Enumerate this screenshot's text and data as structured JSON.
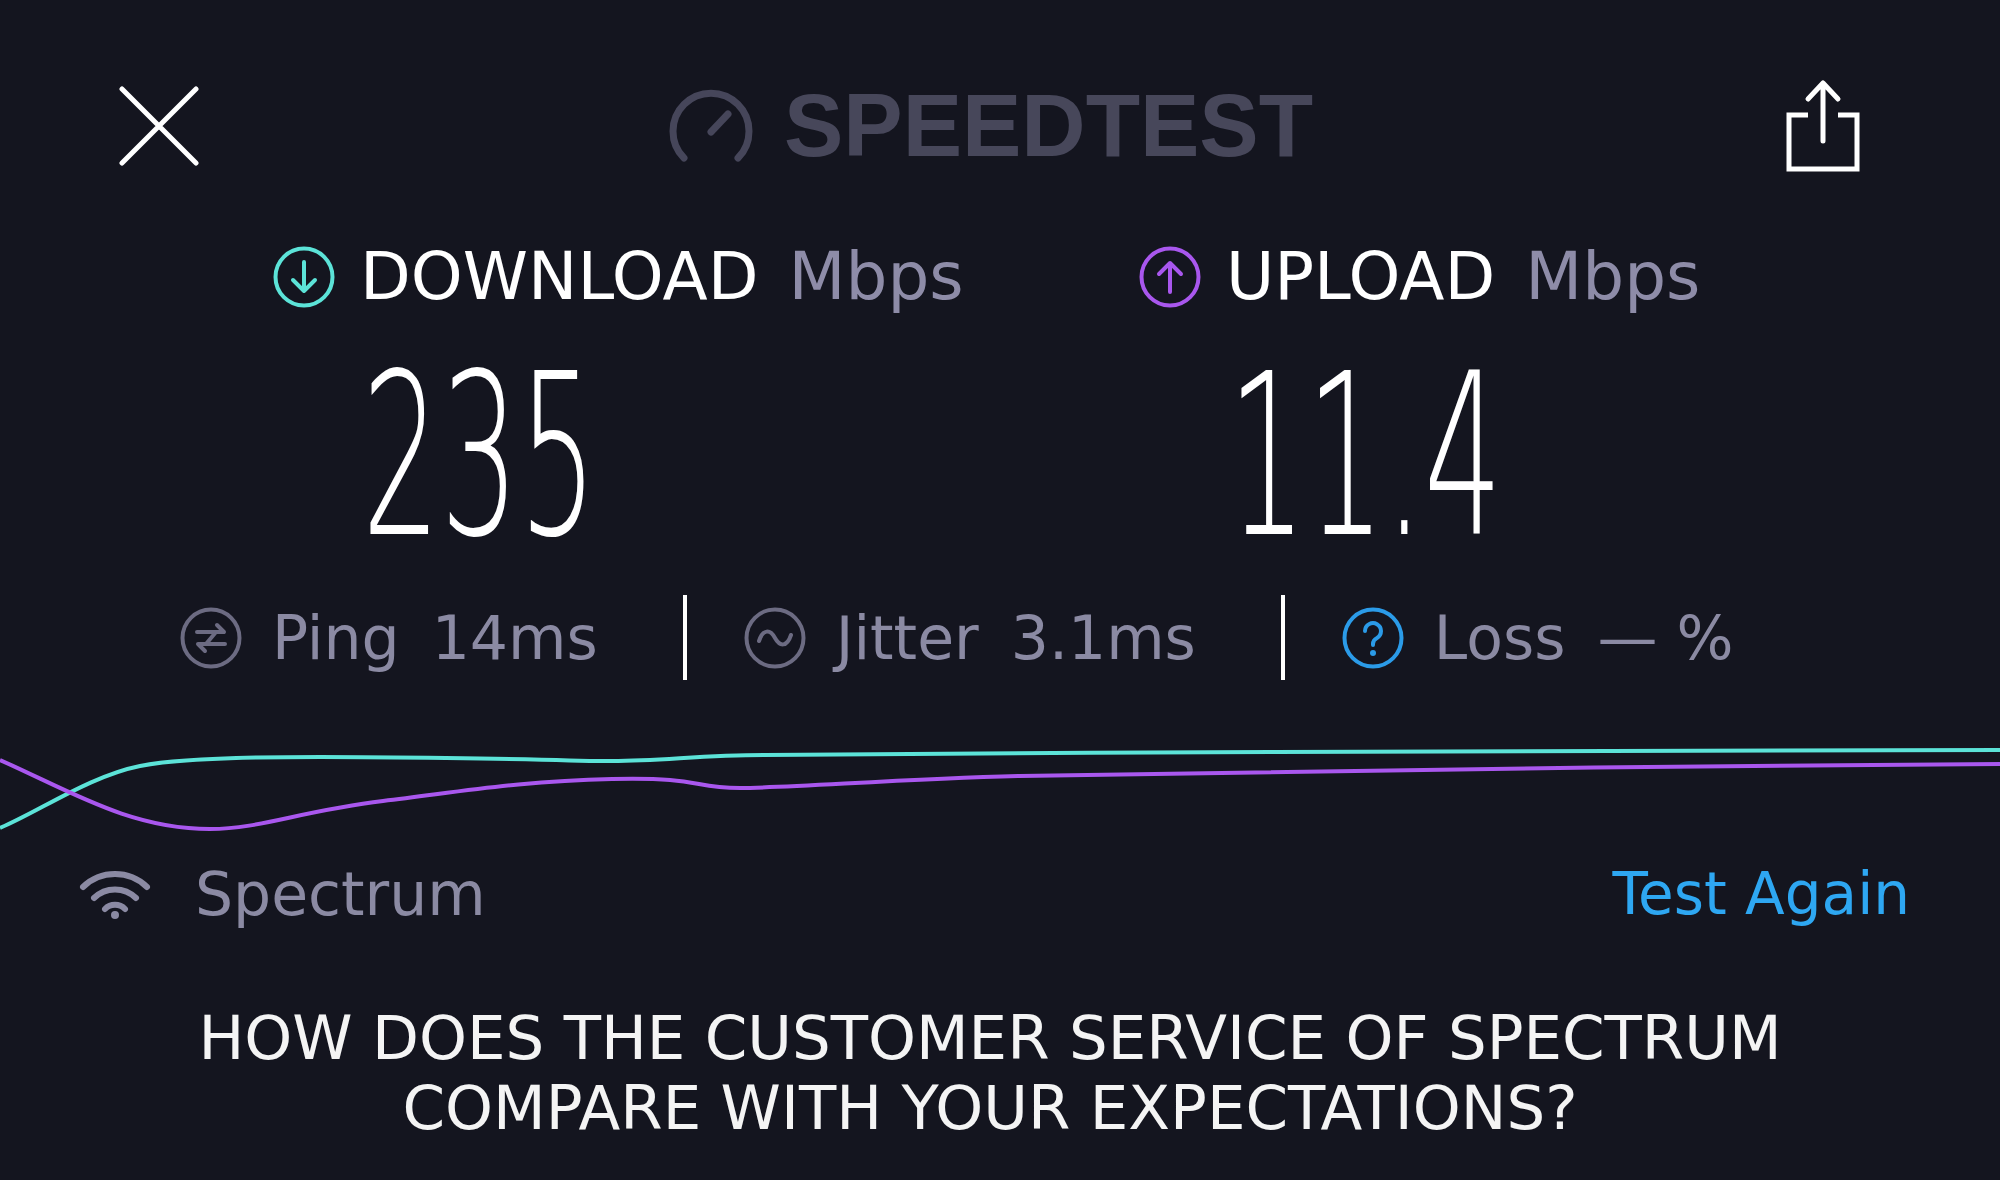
{
  "header": {
    "logo": "SPEEDTEST"
  },
  "results": [
    {
      "kind": "download",
      "label": "DOWNLOAD",
      "unit": "Mbps",
      "value": "235",
      "color": "#5ce3d8"
    },
    {
      "kind": "upload",
      "label": "UPLOAD",
      "unit": "Mbps",
      "value": "11.4",
      "color": "#a957ee"
    }
  ],
  "metrics": [
    {
      "kind": "ping",
      "label": "Ping",
      "value": "14ms"
    },
    {
      "kind": "jitter",
      "label": "Jitter",
      "value": "3.1ms"
    },
    {
      "kind": "loss",
      "label": "Loss",
      "value": "— %"
    }
  ],
  "provider": {
    "name": "Spectrum"
  },
  "actions": {
    "test_again": "Test Again"
  },
  "survey": {
    "question": "HOW DOES THE CUSTOMER SERVICE OF SPECTRUM COMPARE WITH YOUR EXPECTATIONS?"
  }
}
